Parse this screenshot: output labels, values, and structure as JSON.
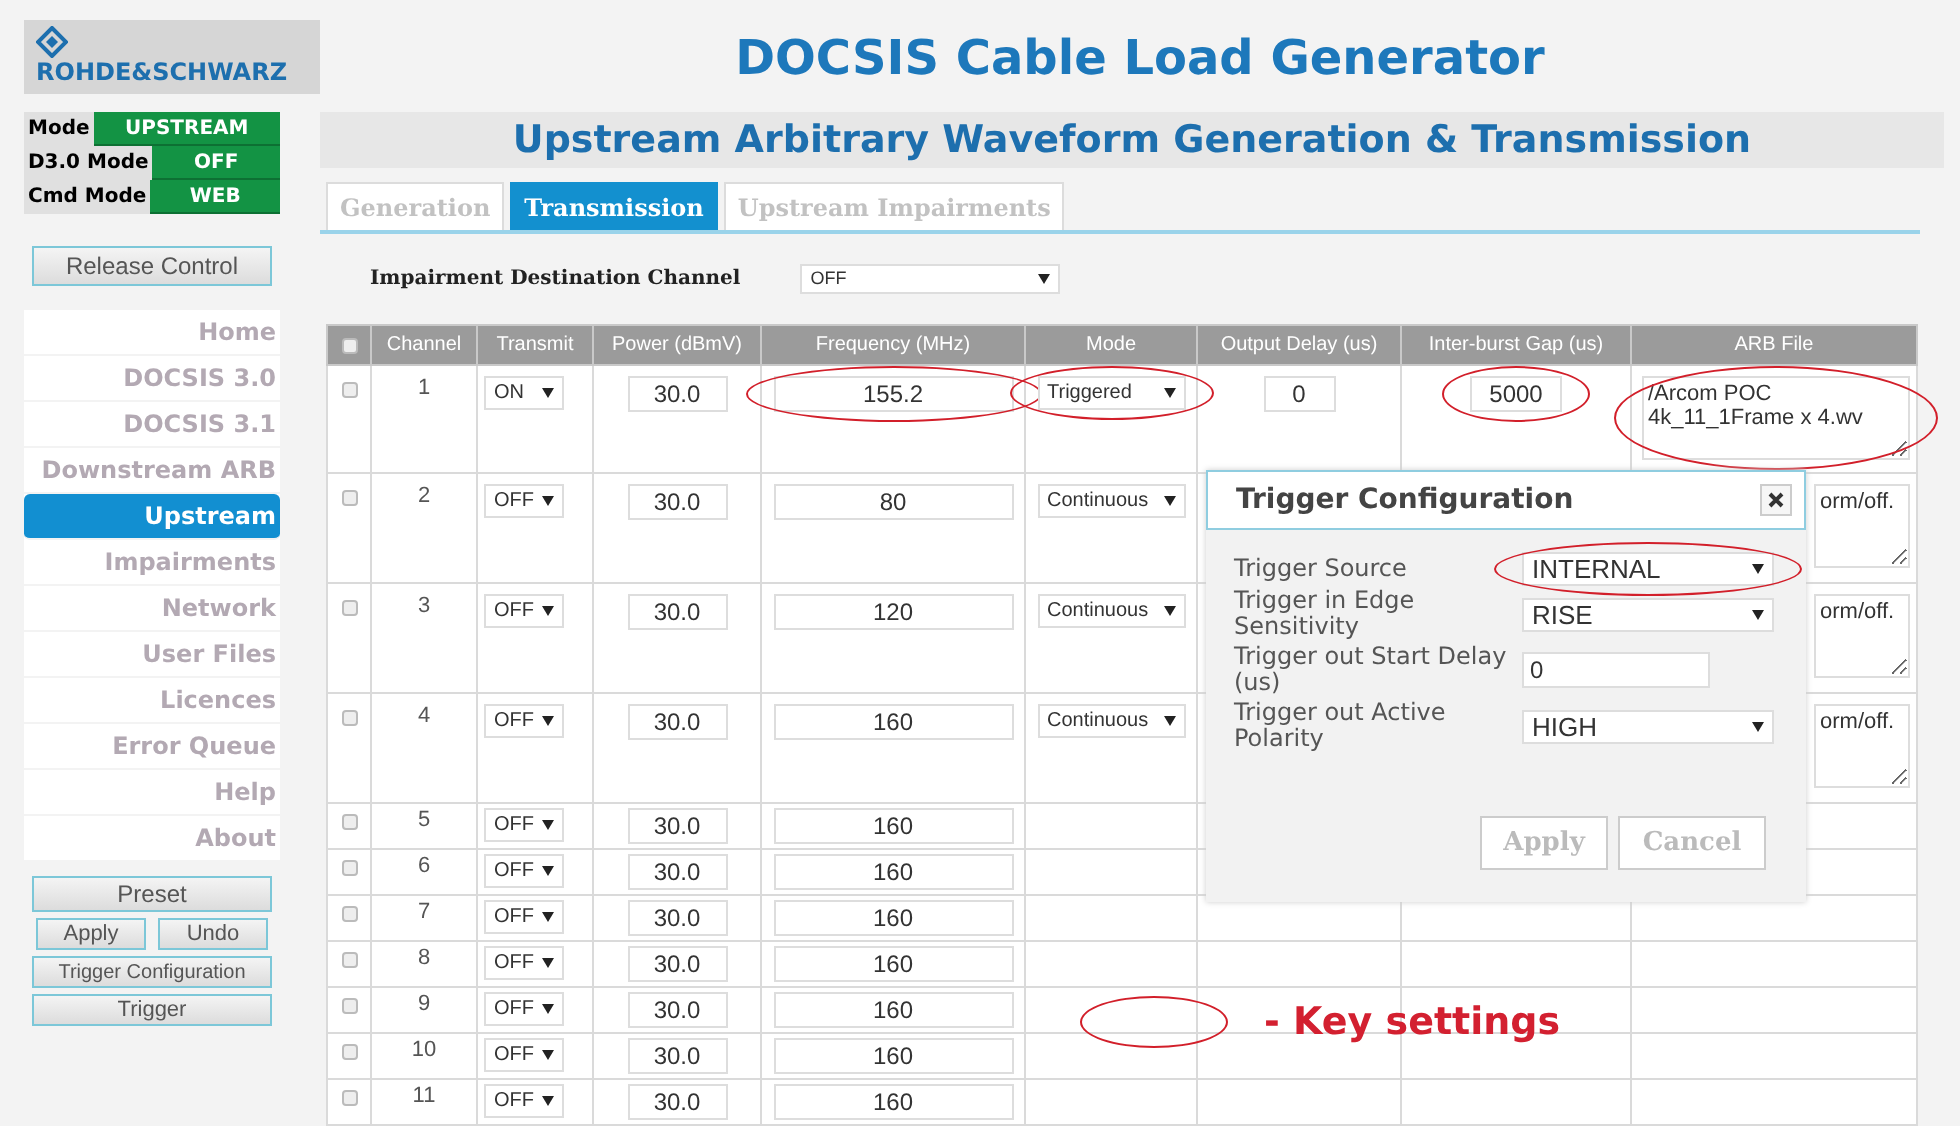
{
  "header": {
    "logo": "ROHDE&SCHWARZ",
    "title": "DOCSIS Cable Load Generator"
  },
  "status": [
    {
      "label": "Mode",
      "value": "UPSTREAM"
    },
    {
      "label": "D3.0 Mode",
      "value": "OFF"
    },
    {
      "label": "Cmd Mode",
      "value": "WEB"
    }
  ],
  "release_button": "Release Control",
  "nav": [
    {
      "label": "Home",
      "selected": false
    },
    {
      "label": "DOCSIS 3.0",
      "selected": false
    },
    {
      "label": "DOCSIS 3.1",
      "selected": false
    },
    {
      "label": "Downstream ARB",
      "selected": false
    },
    {
      "label": "Upstream",
      "selected": true
    },
    {
      "label": "Impairments",
      "selected": false
    },
    {
      "label": "Network",
      "selected": false
    },
    {
      "label": "User Files",
      "selected": false
    },
    {
      "label": "Licences",
      "selected": false
    },
    {
      "label": "Error Queue",
      "selected": false
    },
    {
      "label": "Help",
      "selected": false
    },
    {
      "label": "About",
      "selected": false
    }
  ],
  "actions": {
    "preset": "Preset",
    "apply": "Apply",
    "undo": "Undo",
    "trigger_config": "Trigger Configuration",
    "trigger": "Trigger"
  },
  "page_title": "Upstream Arbitrary Waveform Generation & Transmission",
  "tabs": [
    {
      "label": "Generation",
      "selected": false
    },
    {
      "label": "Transmission",
      "selected": true
    },
    {
      "label": "Upstream Impairments",
      "selected": false
    }
  ],
  "impairment": {
    "label": "Impairment Destination Channel",
    "value": "OFF"
  },
  "table": {
    "header_checked": false,
    "columns": [
      "Channel",
      "Transmit",
      "Power (dBmV)",
      "Frequency (MHz)",
      "Mode",
      "Output Delay (us)",
      "Inter-burst Gap (us)",
      "ARB File"
    ],
    "rows": [
      {
        "checked": false,
        "channel": "1",
        "transmit": "ON",
        "power": "30.0",
        "frequency": "155.2",
        "mode": "Triggered",
        "output_delay": "0",
        "gap": "5000",
        "arb_file": "/Arcom POC\n4k_11_1Frame x 4.wv",
        "circled": true
      },
      {
        "checked": false,
        "channel": "2",
        "transmit": "OFF",
        "power": "30.0",
        "frequency": "80",
        "mode": "Continuous",
        "arb_file": "orm/off.",
        "circled": false
      },
      {
        "checked": false,
        "channel": "3",
        "transmit": "OFF",
        "power": "30.0",
        "frequency": "120",
        "mode": "Continuous",
        "arb_file": "orm/off.",
        "circled": false
      },
      {
        "checked": false,
        "channel": "4",
        "transmit": "OFF",
        "power": "30.0",
        "frequency": "160",
        "mode": "Continuous",
        "arb_file": "orm/off.",
        "circled": false
      },
      {
        "checked": false,
        "channel": "5",
        "transmit": "OFF",
        "power": "30.0",
        "frequency": "160",
        "circled": false
      },
      {
        "checked": false,
        "channel": "6",
        "transmit": "OFF",
        "power": "30.0",
        "frequency": "160",
        "circled": false
      },
      {
        "checked": false,
        "channel": "7",
        "transmit": "OFF",
        "power": "30.0",
        "frequency": "160",
        "circled": false
      },
      {
        "checked": false,
        "channel": "8",
        "transmit": "OFF",
        "power": "30.0",
        "frequency": "160",
        "circled": false
      },
      {
        "checked": false,
        "channel": "9",
        "transmit": "OFF",
        "power": "30.0",
        "frequency": "160",
        "circled": false
      },
      {
        "checked": false,
        "channel": "10",
        "transmit": "OFF",
        "power": "30.0",
        "frequency": "160",
        "circled": false
      },
      {
        "checked": false,
        "channel": "11",
        "transmit": "OFF",
        "power": "30.0",
        "frequency": "160",
        "circled": false
      }
    ]
  },
  "dialog": {
    "title": "Trigger Configuration",
    "fields": [
      {
        "label": "Trigger Source",
        "kind": "select",
        "value": "INTERNAL",
        "circled": true
      },
      {
        "label": "Trigger in Edge Sensitivity",
        "kind": "select",
        "value": "RISE",
        "circled": false
      },
      {
        "label": "Trigger out Start Delay (us)",
        "kind": "input",
        "value": "0",
        "circled": false
      },
      {
        "label": "Trigger out Active Polarity",
        "kind": "select",
        "value": "HIGH",
        "circled": false
      }
    ],
    "buttons": [
      {
        "label": "Apply",
        "disabled": true
      },
      {
        "label": "Cancel",
        "disabled": true
      }
    ]
  },
  "legend": {
    "text": "- Key settings"
  }
}
